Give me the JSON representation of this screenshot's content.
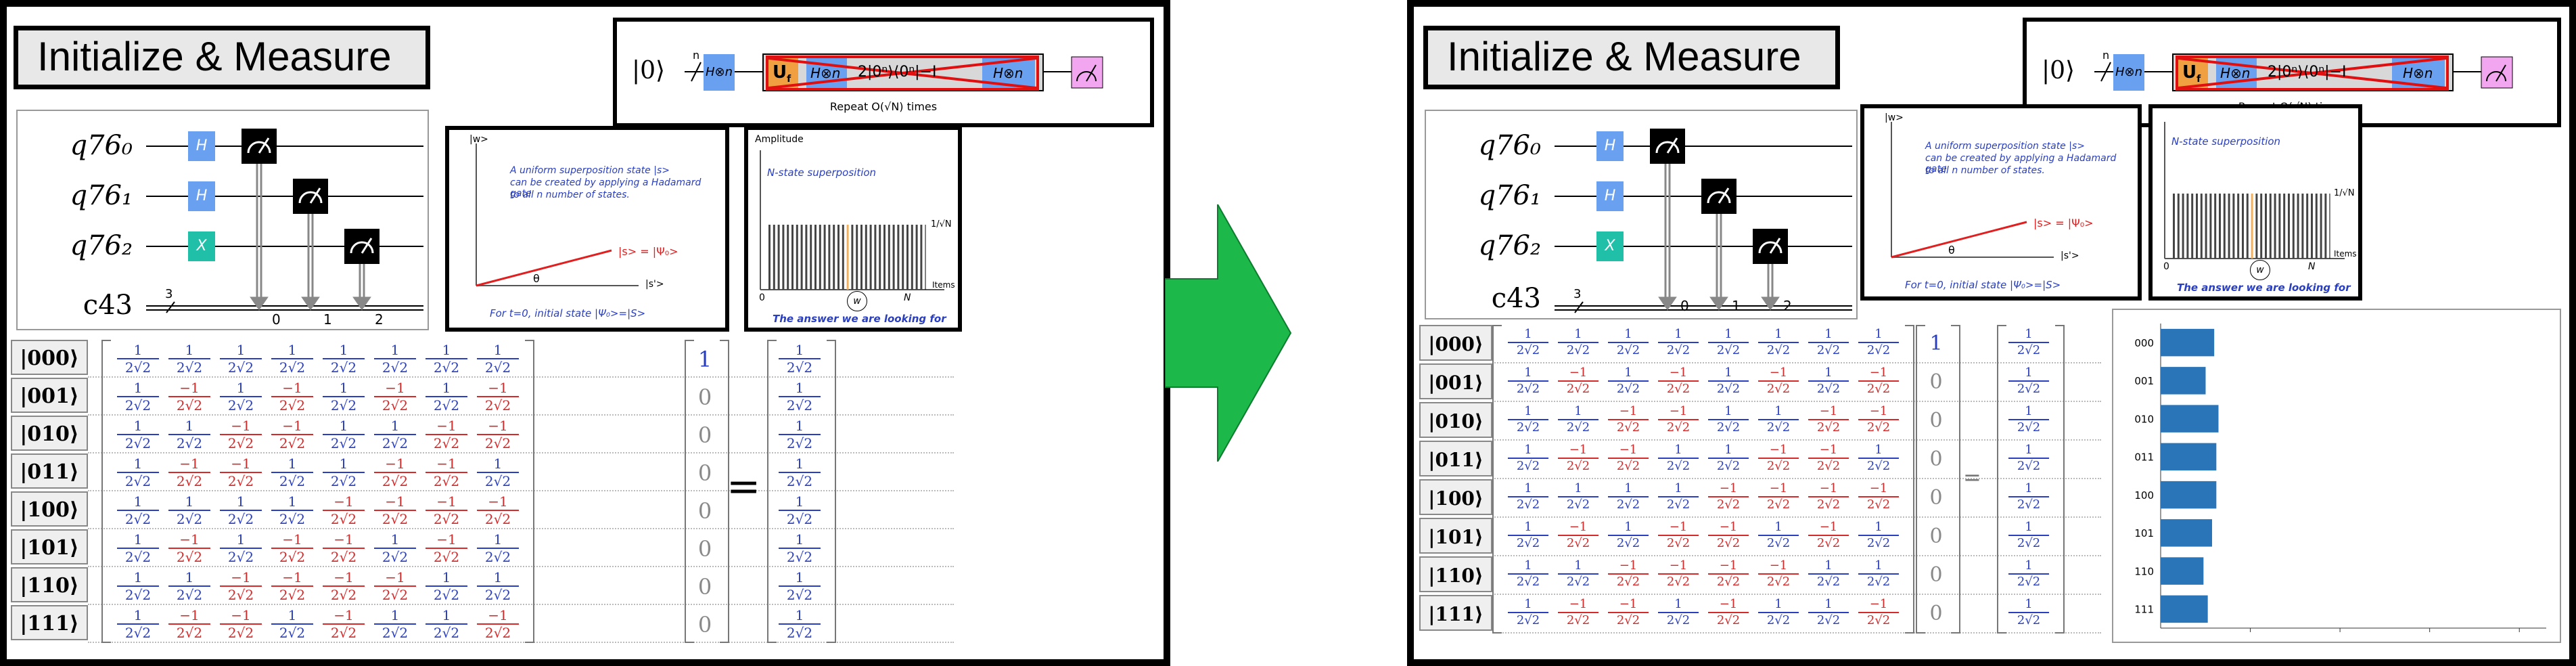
{
  "title": "Initialize & Measure",
  "circuit": {
    "qubits": [
      "q76₀",
      "q76₁",
      "q76₂"
    ],
    "creg": "c43",
    "creg_size": "3",
    "creg_bits": [
      "0",
      "1",
      "2"
    ],
    "gates": [
      "H",
      "H",
      "X"
    ],
    "colors": {
      "h": "#6aa0f0",
      "x": "#1fbfa8",
      "measure": "#000000"
    }
  },
  "grover_strip": {
    "ket": "|0⟩",
    "n": "n",
    "h": "H⊗n",
    "uf": "U",
    "uf_sub": "f",
    "diffuser": "2|0ⁿ⟩⟨0ⁿ|−I",
    "h2": "H⊗n",
    "caption": "Repeat O(√N) times"
  },
  "vector_plot": {
    "yaxis": "|w>",
    "xaxis": "|s'>",
    "note1": "A uniform superposition state |s>",
    "note2": "can be created by applying a Hadamard gate",
    "note3": "to all n number of states.",
    "state_label": "|s> = |Ψ₀>",
    "theta": "θ",
    "caption": "For t=0, initial state |Ψ₀>=|S>"
  },
  "amp_plot": {
    "ylabel": "Amplitude",
    "title": "N-state superposition",
    "marker": "1/√N",
    "x0": "0",
    "xN": "N",
    "items": "Items",
    "w": "w",
    "caption": "The answer we are looking for"
  },
  "matrix": {
    "kets": [
      "|000⟩",
      "|001⟩",
      "|010⟩",
      "|011⟩",
      "|100⟩",
      "|101⟩",
      "|110⟩",
      "|111⟩"
    ],
    "pos_num": "1",
    "neg_num": "−1",
    "den": "2√2",
    "signs": [
      [
        1,
        1,
        1,
        1,
        1,
        1,
        1,
        1
      ],
      [
        1,
        -1,
        1,
        -1,
        1,
        -1,
        1,
        -1
      ],
      [
        1,
        1,
        -1,
        -1,
        1,
        1,
        -1,
        -1
      ],
      [
        1,
        -1,
        -1,
        1,
        1,
        -1,
        -1,
        1
      ],
      [
        1,
        1,
        1,
        1,
        -1,
        -1,
        -1,
        -1
      ],
      [
        1,
        -1,
        1,
        -1,
        -1,
        1,
        -1,
        1
      ],
      [
        1,
        1,
        -1,
        -1,
        -1,
        -1,
        1,
        1
      ],
      [
        1,
        -1,
        -1,
        1,
        -1,
        1,
        1,
        -1
      ]
    ],
    "input_vector": [
      "1",
      "0",
      "0",
      "0",
      "0",
      "0",
      "0",
      "0"
    ],
    "equals": "=",
    "result_num": "1",
    "result_den": "2√2"
  },
  "chart_data": {
    "type": "bar",
    "orientation": "horizontal",
    "categories": [
      "000",
      "001",
      "010",
      "011",
      "100",
      "101",
      "110",
      "111"
    ],
    "values": [
      0.125,
      0.105,
      0.135,
      0.13,
      0.13,
      0.12,
      0.1,
      0.11
    ],
    "xlim": [
      0,
      0.9
    ],
    "color": "#2a74b8"
  },
  "arrow_color": "#1cb84a"
}
